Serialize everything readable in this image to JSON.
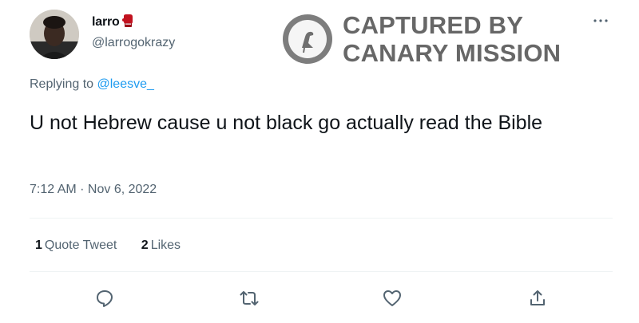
{
  "author": {
    "display_name": "larro",
    "handle": "@larrogokrazy",
    "badge_emoji": "boxing-glove-emoji"
  },
  "watermark": {
    "line1": "CAPTURED BY",
    "line2": "CANARY MISSION",
    "logo": "canary-bird-icon"
  },
  "reply": {
    "prefix": "Replying to ",
    "mention": "@leesve_"
  },
  "tweet": {
    "text": "U not Hebrew cause u not black go actually read the Bible",
    "timestamp": "7:12 AM · Nov 6, 2022"
  },
  "stats": {
    "quote_count": "1",
    "quote_label": "Quote Tweet",
    "like_count": "2",
    "like_label": "Likes"
  },
  "actions": [
    "reply-icon",
    "retweet-icon",
    "like-icon",
    "share-icon"
  ],
  "colors": {
    "text": "#0f1419",
    "secondary": "#536471",
    "link": "#1d9bf0",
    "divider": "#eff3f4",
    "watermark": "#5b5b5b"
  }
}
